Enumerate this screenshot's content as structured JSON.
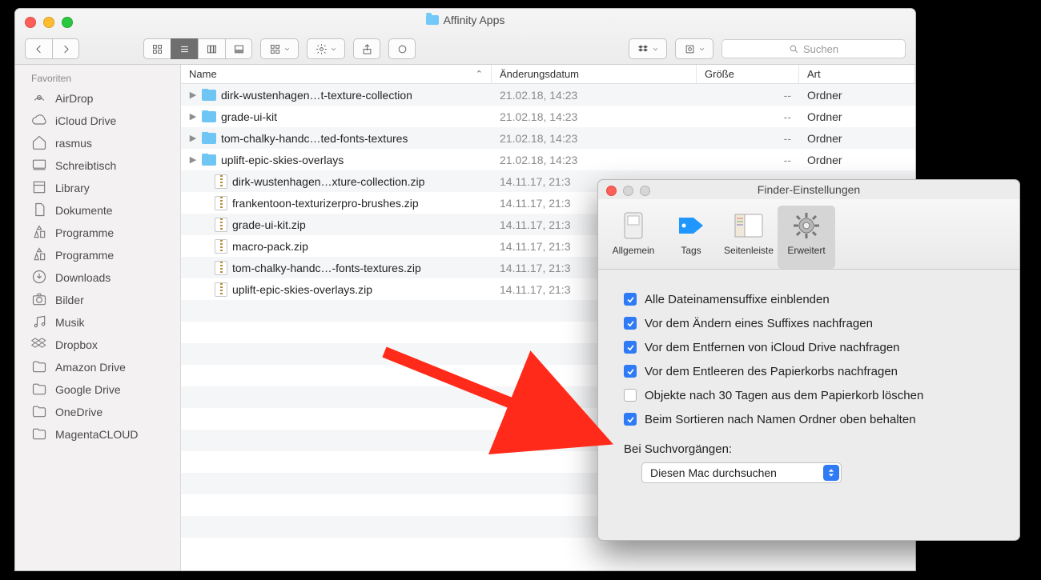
{
  "finder": {
    "title": "Affinity Apps",
    "search_placeholder": "Suchen",
    "sidebar": {
      "section": "Favoriten",
      "items": [
        {
          "icon": "airdrop",
          "label": "AirDrop"
        },
        {
          "icon": "cloud",
          "label": "iCloud Drive"
        },
        {
          "icon": "home",
          "label": "rasmus"
        },
        {
          "icon": "desktop",
          "label": "Schreibtisch"
        },
        {
          "icon": "library",
          "label": "Library"
        },
        {
          "icon": "docs",
          "label": "Dokumente"
        },
        {
          "icon": "apps",
          "label": "Programme"
        },
        {
          "icon": "apps",
          "label": "Programme"
        },
        {
          "icon": "downloads",
          "label": "Downloads"
        },
        {
          "icon": "camera",
          "label": "Bilder"
        },
        {
          "icon": "music",
          "label": "Musik"
        },
        {
          "icon": "dropbox",
          "label": "Dropbox"
        },
        {
          "icon": "folder",
          "label": "Amazon Drive"
        },
        {
          "icon": "folder",
          "label": "Google Drive"
        },
        {
          "icon": "folder",
          "label": "OneDrive"
        },
        {
          "icon": "folder",
          "label": "MagentaCLOUD"
        }
      ]
    },
    "columns": {
      "name": "Name",
      "date": "Änderungsdatum",
      "size": "Größe",
      "kind": "Art"
    },
    "rows": [
      {
        "type": "folder",
        "name": "dirk-wustenhagen…t-texture-collection",
        "date": "21.02.18, 14:23",
        "size": "--",
        "kind": "Ordner"
      },
      {
        "type": "folder",
        "name": "grade-ui-kit",
        "date": "21.02.18, 14:23",
        "size": "--",
        "kind": "Ordner"
      },
      {
        "type": "folder",
        "name": "tom-chalky-handc…ted-fonts-textures",
        "date": "21.02.18, 14:23",
        "size": "--",
        "kind": "Ordner"
      },
      {
        "type": "folder",
        "name": "uplift-epic-skies-overlays",
        "date": "21.02.18, 14:23",
        "size": "--",
        "kind": "Ordner"
      },
      {
        "type": "zip",
        "name": "dirk-wustenhagen…xture-collection.zip",
        "date": "14.11.17, 21:3",
        "size": "",
        "kind": ""
      },
      {
        "type": "zip",
        "name": "frankentoon-texturizerpro-brushes.zip",
        "date": "14.11.17, 21:3",
        "size": "",
        "kind": ""
      },
      {
        "type": "zip",
        "name": "grade-ui-kit.zip",
        "date": "14.11.17, 21:3",
        "size": "",
        "kind": ""
      },
      {
        "type": "zip",
        "name": "macro-pack.zip",
        "date": "14.11.17, 21:3",
        "size": "",
        "kind": ""
      },
      {
        "type": "zip",
        "name": "tom-chalky-handc…-fonts-textures.zip",
        "date": "14.11.17, 21:3",
        "size": "",
        "kind": ""
      },
      {
        "type": "zip",
        "name": "uplift-epic-skies-overlays.zip",
        "date": "14.11.17, 21:3",
        "size": "",
        "kind": ""
      }
    ]
  },
  "prefs": {
    "title": "Finder-Einstellungen",
    "tabs": {
      "general": "Allgemein",
      "tags": "Tags",
      "sidebar": "Seitenleiste",
      "advanced": "Erweitert"
    },
    "checks": [
      {
        "on": true,
        "label": "Alle Dateinamensuffixe einblenden"
      },
      {
        "on": true,
        "label": "Vor dem Ändern eines Suffixes nachfragen"
      },
      {
        "on": true,
        "label": "Vor dem Entfernen von iCloud Drive nachfragen"
      },
      {
        "on": true,
        "label": "Vor dem Entleeren des Papierkorbs nachfragen"
      },
      {
        "on": false,
        "label": "Objekte nach 30 Tagen aus dem Papierkorb löschen"
      },
      {
        "on": true,
        "label": "Beim Sortieren nach Namen Ordner oben behalten"
      }
    ],
    "search_label": "Bei Suchvorgängen:",
    "search_select": "Diesen Mac durchsuchen"
  }
}
